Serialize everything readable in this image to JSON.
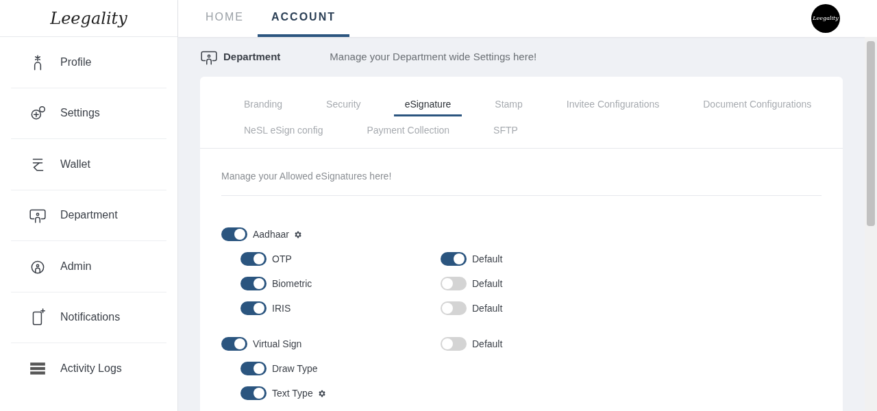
{
  "logo": "Leegality",
  "nav_tabs": [
    {
      "label": "HOME",
      "selected": false
    },
    {
      "label": "ACCOUNT",
      "selected": true
    }
  ],
  "avatar": "Leegality",
  "sidebar": {
    "items": [
      {
        "label": "Profile",
        "selected": false
      },
      {
        "label": "Settings",
        "selected": false
      },
      {
        "label": "Wallet",
        "selected": false
      },
      {
        "label": "Department",
        "selected": false
      },
      {
        "label": "Admin",
        "selected": false
      },
      {
        "label": "Notifications",
        "selected": false
      },
      {
        "label": "Activity Logs",
        "selected": false
      }
    ]
  },
  "page_header": {
    "title": "Department",
    "subtitle": "Manage your Department wide Settings here!"
  },
  "tabs": [
    [
      {
        "label": "Branding",
        "selected": false
      },
      {
        "label": "Security",
        "selected": false
      },
      {
        "label": "eSignature",
        "selected": true
      },
      {
        "label": "Stamp",
        "selected": false
      },
      {
        "label": "Invitee Configurations",
        "selected": false
      },
      {
        "label": "Document Configurations",
        "selected": false
      }
    ],
    [
      {
        "label": "NeSL eSign config",
        "selected": false
      },
      {
        "label": "Payment Collection",
        "selected": false
      },
      {
        "label": "SFTP",
        "selected": false
      }
    ]
  ],
  "section_hint": "Manage your Allowed eSignatures here!",
  "options": [
    {
      "label": "Aadhaar",
      "on": true,
      "gear": true,
      "children": [
        {
          "label": "OTP",
          "on": true,
          "gear": false,
          "default": {
            "label": "Default",
            "on": true
          }
        },
        {
          "label": "Biometric",
          "on": true,
          "gear": false,
          "default": {
            "label": "Default",
            "on": false
          }
        },
        {
          "label": "IRIS",
          "on": true,
          "gear": false,
          "default": {
            "label": "Default",
            "on": false
          }
        }
      ]
    },
    {
      "label": "Virtual Sign",
      "on": true,
      "gear": false,
      "default": {
        "label": "Default",
        "on": false
      },
      "children": [
        {
          "label": "Draw Type",
          "on": true,
          "gear": false
        },
        {
          "label": "Text Type",
          "on": true,
          "gear": true
        }
      ]
    }
  ]
}
